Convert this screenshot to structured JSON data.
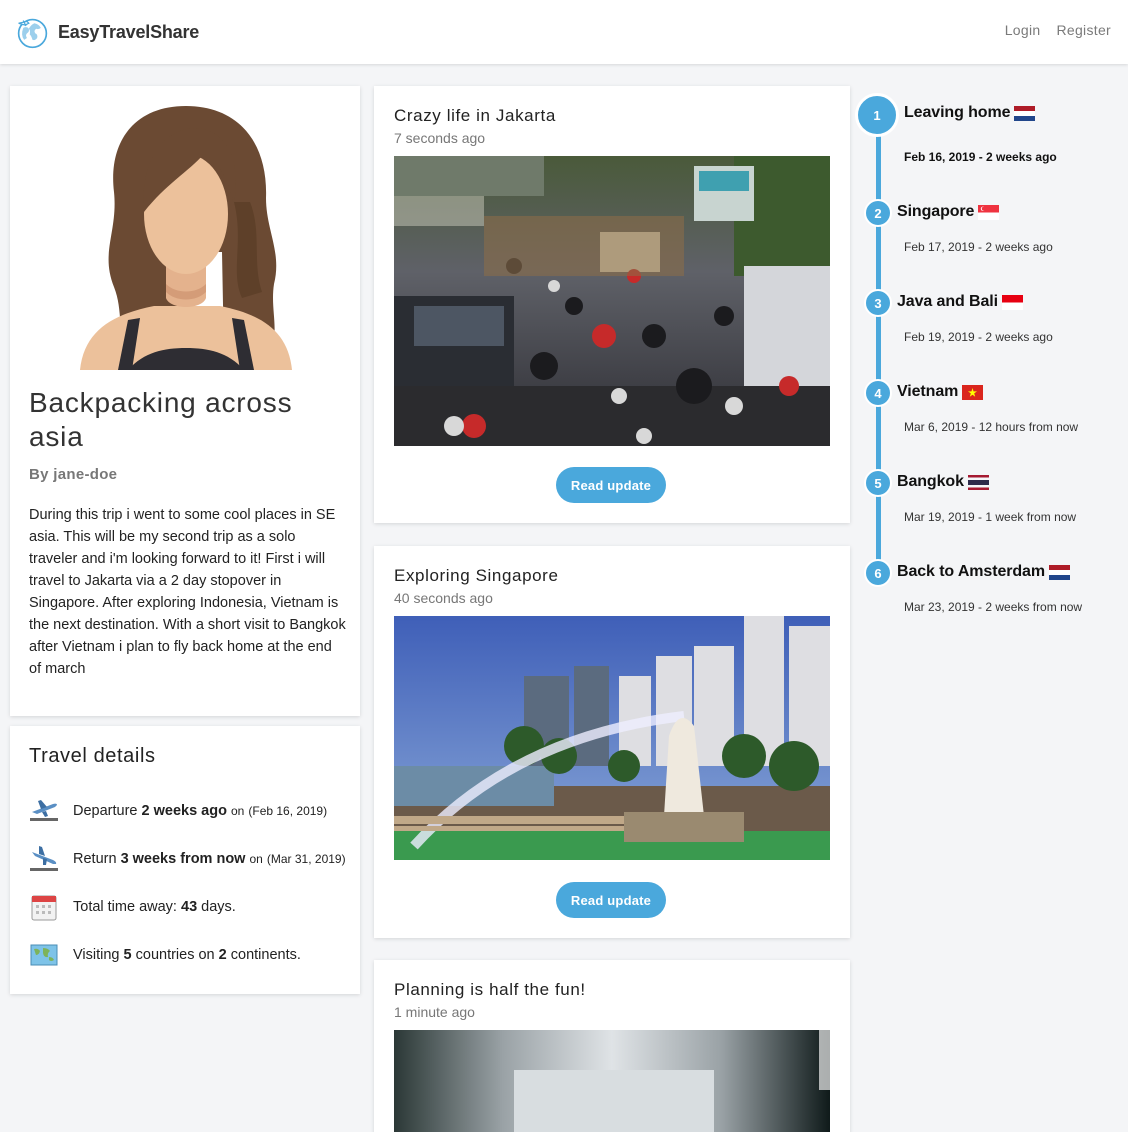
{
  "header": {
    "brand": "EasyTravelShare",
    "login": "Login",
    "register": "Register"
  },
  "profile": {
    "title": "Backpacking across asia",
    "author_prefix": "By",
    "author": "jane-doe",
    "description": "During this trip i went to some cool places in SE asia. This will be my second trip as a solo traveler and i'm looking forward to it! First i will travel to Jakarta via a 2 day stopover in Singapore. After exploring Indonesia, Vietnam is the next destination. With a short visit to Bangkok after Vietnam i plan to fly back home at the end of march"
  },
  "details": {
    "title": "Travel details",
    "departure": {
      "label": "Departure",
      "value": "2 weeks ago",
      "on": "on",
      "date": "(Feb 16, 2019)"
    },
    "return": {
      "label": "Return",
      "value": "3 weeks from now",
      "on": "on",
      "date": "(Mar 31, 2019)"
    },
    "total": {
      "label": "Total time away:",
      "value": "43",
      "unit": "days."
    },
    "visiting": {
      "label": "Visiting",
      "countries": "5",
      "mid": "countries on",
      "continents": "2",
      "end": "continents."
    }
  },
  "posts": [
    {
      "title": "Crazy life in Jakarta",
      "time": "7 seconds ago",
      "button": "Read update"
    },
    {
      "title": "Exploring Singapore",
      "time": "40 seconds ago",
      "button": "Read update"
    },
    {
      "title": "Planning is half the fun!",
      "time": "1 minute ago"
    }
  ],
  "timeline": [
    {
      "number": "1",
      "name": "Leaving home",
      "flag": "nl",
      "date": "Feb 16, 2019 - 2 weeks ago"
    },
    {
      "number": "2",
      "name": "Singapore",
      "flag": "sg",
      "date": "Feb 17, 2019 - 2 weeks ago"
    },
    {
      "number": "3",
      "name": "Java and Bali",
      "flag": "id",
      "date": "Feb 19, 2019 - 2 weeks ago"
    },
    {
      "number": "4",
      "name": "Vietnam",
      "flag": "vn",
      "date": "Mar 6, 2019 - 12 hours from now"
    },
    {
      "number": "5",
      "name": "Bangkok",
      "flag": "th",
      "date": "Mar 19, 2019 - 1 week from now"
    },
    {
      "number": "6",
      "name": "Back to Amsterdam",
      "flag": "nl",
      "date": "Mar 23, 2019 - 2 weeks from now"
    }
  ],
  "colors": {
    "accent": "#4aa8dc",
    "background": "#f4f5f7"
  }
}
